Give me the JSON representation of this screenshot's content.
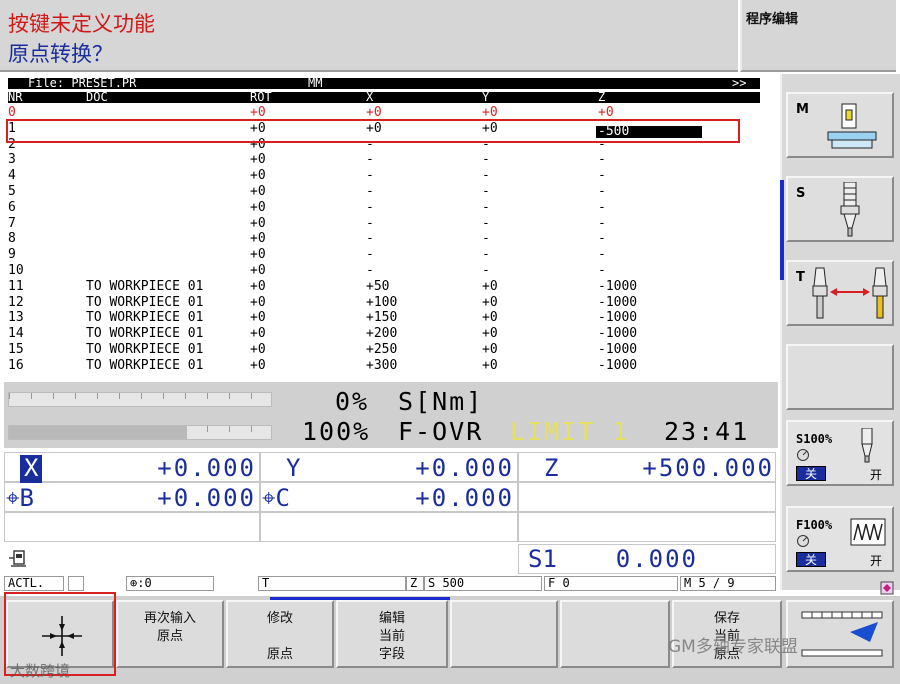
{
  "header": {
    "message_line1": "按键未定义功能",
    "message_line2": "原点转换？",
    "mode": "程序编辑"
  },
  "table": {
    "file_label": "File: PRESET.PR",
    "unit": "MM",
    "end_marker": ">>",
    "columns": [
      "NR",
      "DOC",
      "ROT",
      "X",
      "Y",
      "Z"
    ],
    "rows": [
      {
        "nr": "0",
        "doc": "",
        "rot": "+0",
        "x": "+0",
        "y": "+0",
        "z": "+0"
      },
      {
        "nr": "1",
        "doc": "",
        "rot": "+0",
        "x": "+0",
        "y": "+0",
        "z": "-500"
      },
      {
        "nr": "2",
        "doc": "",
        "rot": "+0",
        "x": "-",
        "y": "-",
        "z": "-"
      },
      {
        "nr": "3",
        "doc": "",
        "rot": "+0",
        "x": "-",
        "y": "-",
        "z": "-"
      },
      {
        "nr": "4",
        "doc": "",
        "rot": "+0",
        "x": "-",
        "y": "-",
        "z": "-"
      },
      {
        "nr": "5",
        "doc": "",
        "rot": "+0",
        "x": "-",
        "y": "-",
        "z": "-"
      },
      {
        "nr": "6",
        "doc": "",
        "rot": "+0",
        "x": "-",
        "y": "-",
        "z": "-"
      },
      {
        "nr": "7",
        "doc": "",
        "rot": "+0",
        "x": "-",
        "y": "-",
        "z": "-"
      },
      {
        "nr": "8",
        "doc": "",
        "rot": "+0",
        "x": "-",
        "y": "-",
        "z": "-"
      },
      {
        "nr": "9",
        "doc": "",
        "rot": "+0",
        "x": "-",
        "y": "-",
        "z": "-"
      },
      {
        "nr": "10",
        "doc": "",
        "rot": "+0",
        "x": "-",
        "y": "-",
        "z": "-"
      },
      {
        "nr": "11",
        "doc": "TO WORKPIECE 01",
        "rot": "+0",
        "x": "+50",
        "y": "+0",
        "z": "-1000"
      },
      {
        "nr": "12",
        "doc": "TO WORKPIECE 01",
        "rot": "+0",
        "x": "+100",
        "y": "+0",
        "z": "-1000"
      },
      {
        "nr": "13",
        "doc": "TO WORKPIECE 01",
        "rot": "+0",
        "x": "+150",
        "y": "+0",
        "z": "-1000"
      },
      {
        "nr": "14",
        "doc": "TO WORKPIECE 01",
        "rot": "+0",
        "x": "+200",
        "y": "+0",
        "z": "-1000"
      },
      {
        "nr": "15",
        "doc": "TO WORKPIECE 01",
        "rot": "+0",
        "x": "+250",
        "y": "+0",
        "z": "-1000"
      },
      {
        "nr": "16",
        "doc": "TO WORKPIECE 01",
        "rot": "+0",
        "x": "+300",
        "y": "+0",
        "z": "-1000"
      }
    ],
    "active_row": 1,
    "edit_value": "-500"
  },
  "status": {
    "load_pct": "0%",
    "load_label": "S[Nm]",
    "ovr_pct": "100%",
    "ovr_label": "F-OVR",
    "limit_label": "LIMIT 1",
    "time": "23:41",
    "bar1_fill": 0.0,
    "bar2_fill": 0.68
  },
  "axes": {
    "x_label": "X",
    "x_value": "+0.000",
    "y_label": "Y",
    "y_value": "+0.000",
    "z_label": "Z",
    "z_value": "+500.000",
    "b_label": "⌖B",
    "b_value": "+0.000",
    "c_label": "⌖C",
    "c_value": "+0.000",
    "s_label": "S1",
    "s_value": "0.000"
  },
  "statusbar": {
    "mode": "ACTL.",
    "pos_label": "⊕:0",
    "t_label": "T",
    "z_label": "Z",
    "s_label": "S 500",
    "f_label": "F 0",
    "m_label": "M 5 / 9"
  },
  "right_panel": {
    "m_label": "M",
    "s_label": "S",
    "t_label": "T",
    "s_override": "S100%",
    "f_override": "F100%",
    "off_label": "关",
    "on_label": "开"
  },
  "softkeys": [
    {
      "line1": "",
      "line2": "",
      "line3": ""
    },
    {
      "line1": "再次输入",
      "line2": "原点",
      "line3": ""
    },
    {
      "line1": "修改",
      "line2": "",
      "line3": "原点"
    },
    {
      "line1": "编辑",
      "line2": "当前",
      "line3": "字段"
    },
    {
      "line1": "",
      "line2": "",
      "line3": ""
    },
    {
      "line1": "",
      "line2": "",
      "line3": ""
    },
    {
      "line1": "保存",
      "line2": "当前",
      "line3": "原点"
    }
  ],
  "watermark": {
    "brand": "GM多轴专家联盟",
    "corner": "大数跨境"
  },
  "colors": {
    "accent_blue": "#1a2d9c",
    "highlight_red": "#d82020",
    "limit_yellow": "#e6e060"
  }
}
